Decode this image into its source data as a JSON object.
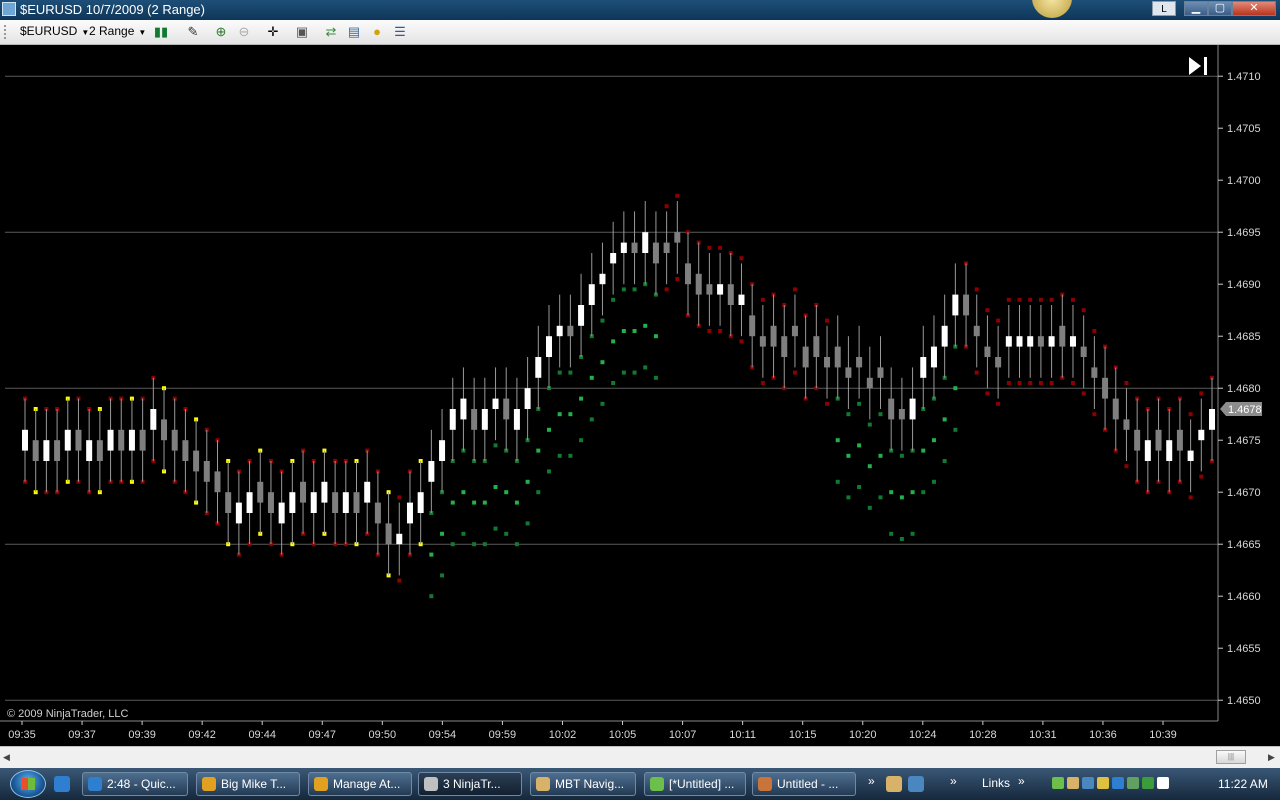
{
  "window": {
    "title": "$EURUSD  10/7/2009 (2 Range)",
    "l_button": "L",
    "minimize": "▁",
    "maximize": "▢",
    "close": "✕"
  },
  "toolbar": {
    "instrument": "$EURUSD",
    "interval": "2 Range"
  },
  "chart": {
    "copyright": "© 2009 NinjaTrader, LLC",
    "current_price_label": "1.4678",
    "y_ticks": [
      "1.4710",
      "1.4705",
      "1.4700",
      "1.4695",
      "1.4690",
      "1.4685",
      "1.4680",
      "1.4675",
      "1.4670",
      "1.4665",
      "1.4660",
      "1.4655",
      "1.4650"
    ],
    "x_ticks": [
      "09:35",
      "09:37",
      "09:39",
      "09:42",
      "09:44",
      "09:47",
      "09:50",
      "09:54",
      "09:59",
      "10:02",
      "10:05",
      "10:07",
      "10:11",
      "10:15",
      "10:20",
      "10:24",
      "10:28",
      "10:31",
      "10:36",
      "10:39"
    ],
    "colors": {
      "background": "#000000",
      "grid": "#5a5a5a",
      "up_bar": "#ffffff",
      "down_bar": "#7f7f7f",
      "dot_green": "#22b14c",
      "dot_dark_green": "#127a30",
      "dot_red": "#e00000",
      "dot_dark_red": "#8b0000",
      "dot_yellow": "#ffff00"
    }
  },
  "chart_data": {
    "type": "candlestick",
    "title": "$EURUSD  10/7/2009 (2 Range)",
    "ylim": [
      1.4648,
      1.4713
    ],
    "y_gridlines": [
      1.471,
      1.4695,
      1.468,
      1.4665,
      1.465
    ],
    "current_price": 1.4678,
    "bars": [
      {
        "o": 1.4674,
        "c": 1.4676
      },
      {
        "o": 1.4675,
        "c": 1.4673
      },
      {
        "o": 1.4673,
        "c": 1.4675
      },
      {
        "o": 1.4675,
        "c": 1.4673
      },
      {
        "o": 1.4674,
        "c": 1.4676
      },
      {
        "o": 1.4676,
        "c": 1.4674
      },
      {
        "o": 1.4673,
        "c": 1.4675
      },
      {
        "o": 1.4675,
        "c": 1.4673
      },
      {
        "o": 1.4674,
        "c": 1.4676
      },
      {
        "o": 1.4676,
        "c": 1.4674
      },
      {
        "o": 1.4674,
        "c": 1.4676
      },
      {
        "o": 1.4676,
        "c": 1.4674
      },
      {
        "o": 1.4676,
        "c": 1.4678
      },
      {
        "o": 1.4677,
        "c": 1.4675
      },
      {
        "o": 1.4676,
        "c": 1.4674
      },
      {
        "o": 1.4675,
        "c": 1.4673
      },
      {
        "o": 1.4674,
        "c": 1.4672
      },
      {
        "o": 1.4673,
        "c": 1.4671
      },
      {
        "o": 1.4672,
        "c": 1.467
      },
      {
        "o": 1.467,
        "c": 1.4668
      },
      {
        "o": 1.4667,
        "c": 1.4669
      },
      {
        "o": 1.4668,
        "c": 1.467
      },
      {
        "o": 1.4671,
        "c": 1.4669
      },
      {
        "o": 1.467,
        "c": 1.4668
      },
      {
        "o": 1.4667,
        "c": 1.4669
      },
      {
        "o": 1.4668,
        "c": 1.467
      },
      {
        "o": 1.4671,
        "c": 1.4669
      },
      {
        "o": 1.4668,
        "c": 1.467
      },
      {
        "o": 1.4669,
        "c": 1.4671
      },
      {
        "o": 1.467,
        "c": 1.4668
      },
      {
        "o": 1.4668,
        "c": 1.467
      },
      {
        "o": 1.467,
        "c": 1.4668
      },
      {
        "o": 1.4669,
        "c": 1.4671
      },
      {
        "o": 1.4669,
        "c": 1.4667
      },
      {
        "o": 1.4667,
        "c": 1.4665
      },
      {
        "o": 1.4665,
        "c": 1.4666
      },
      {
        "o": 1.4667,
        "c": 1.4669
      },
      {
        "o": 1.4668,
        "c": 1.467
      },
      {
        "o": 1.4671,
        "c": 1.4673
      },
      {
        "o": 1.4673,
        "c": 1.4675
      },
      {
        "o": 1.4676,
        "c": 1.4678
      },
      {
        "o": 1.4677,
        "c": 1.4679
      },
      {
        "o": 1.4678,
        "c": 1.4676
      },
      {
        "o": 1.4676,
        "c": 1.4678
      },
      {
        "o": 1.4678,
        "c": 1.4679
      },
      {
        "o": 1.4679,
        "c": 1.4677
      },
      {
        "o": 1.4676,
        "c": 1.4678
      },
      {
        "o": 1.4678,
        "c": 1.468
      },
      {
        "o": 1.4681,
        "c": 1.4683
      },
      {
        "o": 1.4683,
        "c": 1.4685
      },
      {
        "o": 1.4685,
        "c": 1.4686
      },
      {
        "o": 1.4686,
        "c": 1.4685
      },
      {
        "o": 1.4686,
        "c": 1.4688
      },
      {
        "o": 1.4688,
        "c": 1.469
      },
      {
        "o": 1.469,
        "c": 1.4691
      },
      {
        "o": 1.4692,
        "c": 1.4693
      },
      {
        "o": 1.4693,
        "c": 1.4694
      },
      {
        "o": 1.4694,
        "c": 1.4693
      },
      {
        "o": 1.4693,
        "c": 1.4695
      },
      {
        "o": 1.4694,
        "c": 1.4692
      },
      {
        "o": 1.4694,
        "c": 1.4693
      },
      {
        "o": 1.4695,
        "c": 1.4694
      },
      {
        "o": 1.4692,
        "c": 1.469
      },
      {
        "o": 1.4691,
        "c": 1.4689
      },
      {
        "o": 1.469,
        "c": 1.4689
      },
      {
        "o": 1.4689,
        "c": 1.469
      },
      {
        "o": 1.469,
        "c": 1.4688
      },
      {
        "o": 1.4688,
        "c": 1.4689
      },
      {
        "o": 1.4687,
        "c": 1.4685
      },
      {
        "o": 1.4685,
        "c": 1.4684
      },
      {
        "o": 1.4686,
        "c": 1.4684
      },
      {
        "o": 1.4685,
        "c": 1.4683
      },
      {
        "o": 1.4686,
        "c": 1.4685
      },
      {
        "o": 1.4684,
        "c": 1.4682
      },
      {
        "o": 1.4685,
        "c": 1.4683
      },
      {
        "o": 1.4683,
        "c": 1.4682
      },
      {
        "o": 1.4684,
        "c": 1.4682
      },
      {
        "o": 1.4682,
        "c": 1.4681
      },
      {
        "o": 1.4683,
        "c": 1.4682
      },
      {
        "o": 1.4681,
        "c": 1.468
      },
      {
        "o": 1.4682,
        "c": 1.4681
      },
      {
        "o": 1.4679,
        "c": 1.4677
      },
      {
        "o": 1.4678,
        "c": 1.4677
      },
      {
        "o": 1.4677,
        "c": 1.4679
      },
      {
        "o": 1.4681,
        "c": 1.4683
      },
      {
        "o": 1.4682,
        "c": 1.4684
      },
      {
        "o": 1.4684,
        "c": 1.4686
      },
      {
        "o": 1.4687,
        "c": 1.4689
      },
      {
        "o": 1.4689,
        "c": 1.4687
      },
      {
        "o": 1.4686,
        "c": 1.4685
      },
      {
        "o": 1.4684,
        "c": 1.4683
      },
      {
        "o": 1.4683,
        "c": 1.4682
      },
      {
        "o": 1.4684,
        "c": 1.4685
      },
      {
        "o": 1.4684,
        "c": 1.4685
      },
      {
        "o": 1.4684,
        "c": 1.4685
      },
      {
        "o": 1.4685,
        "c": 1.4684
      },
      {
        "o": 1.4684,
        "c": 1.4685
      },
      {
        "o": 1.4686,
        "c": 1.4684
      },
      {
        "o": 1.4684,
        "c": 1.4685
      },
      {
        "o": 1.4684,
        "c": 1.4683
      },
      {
        "o": 1.4682,
        "c": 1.4681
      },
      {
        "o": 1.4681,
        "c": 1.4679
      },
      {
        "o": 1.4679,
        "c": 1.4677
      },
      {
        "o": 1.4677,
        "c": 1.4676
      },
      {
        "o": 1.4676,
        "c": 1.4674
      },
      {
        "o": 1.4673,
        "c": 1.4675
      },
      {
        "o": 1.4676,
        "c": 1.4674
      },
      {
        "o": 1.4673,
        "c": 1.4675
      },
      {
        "o": 1.4676,
        "c": 1.4674
      },
      {
        "o": 1.4673,
        "c": 1.4674
      },
      {
        "o": 1.4675,
        "c": 1.4676
      },
      {
        "o": 1.4676,
        "c": 1.4678
      }
    ]
  },
  "taskbar": {
    "items": [
      {
        "label": "2:48 - Quic...",
        "color": "#2f7fd0"
      },
      {
        "label": "Big Mike T...",
        "color": "#e0a020"
      },
      {
        "label": "Manage At...",
        "color": "#e0a020"
      },
      {
        "label": "3 NinjaTr...",
        "color": "#c0c0c0"
      },
      {
        "label": "MBT Navig...",
        "color": "#d9b26a"
      },
      {
        "label": "[*Untitled] ...",
        "color": "#6cbf4a"
      },
      {
        "label": "Untitled - ...",
        "color": "#c8743a"
      }
    ],
    "links_label": "Links",
    "chevron": "»",
    "clock": "11:22 AM"
  }
}
